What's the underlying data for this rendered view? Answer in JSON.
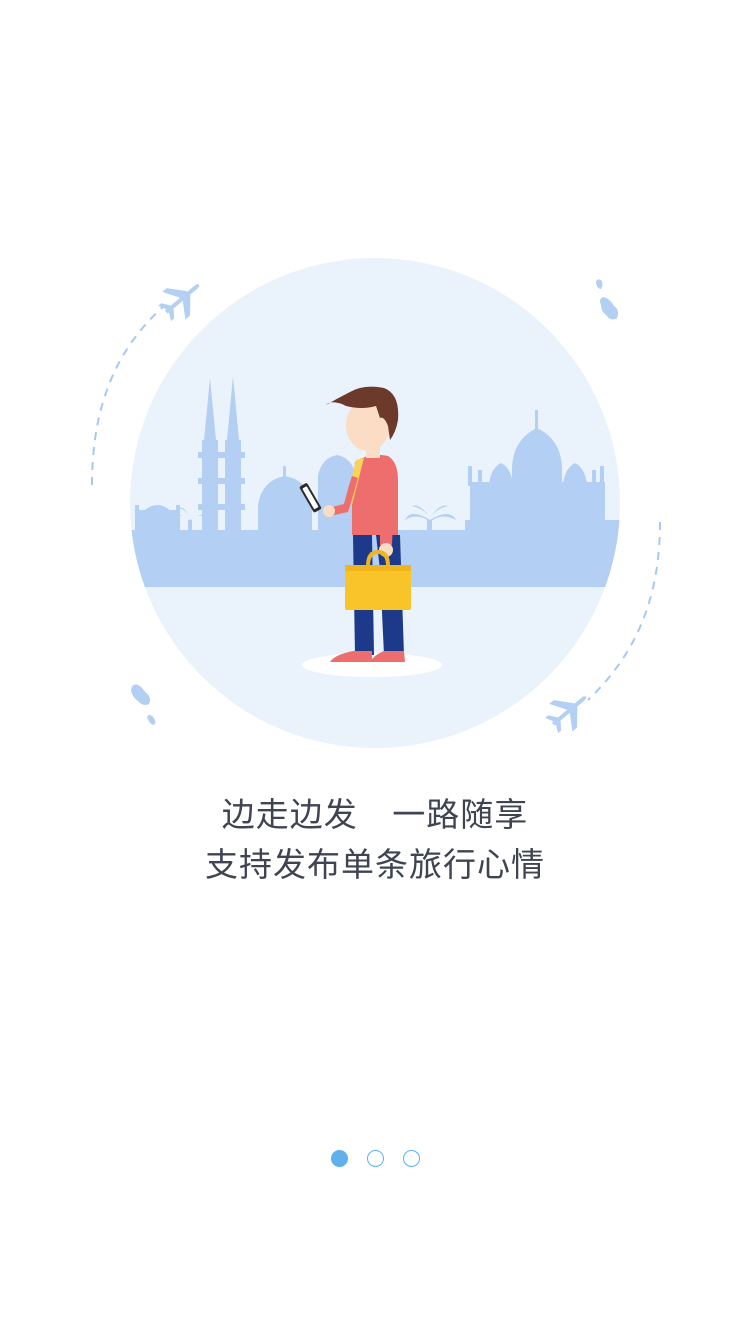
{
  "colors": {
    "accent": "#5fb0ec",
    "circle_bg": "#eaf3fc",
    "skyline": "#b3cff3",
    "text": "#3f4452",
    "shirt": "#ee6e6e",
    "pants": "#1d3a8a",
    "bag": "#f8c42a",
    "hair": "#6b3a2a"
  },
  "illustration": {
    "icons": [
      "airplane-icon",
      "cloud-icon",
      "person-icon",
      "briefcase-icon",
      "phone-icon",
      "mosque-icon",
      "palace-icon",
      "palm-tree-icon"
    ]
  },
  "caption": {
    "line1": "边走边发   一路随享",
    "line2": "支持发布单条旅行心情"
  },
  "pager": {
    "total": 3,
    "current": 1
  }
}
